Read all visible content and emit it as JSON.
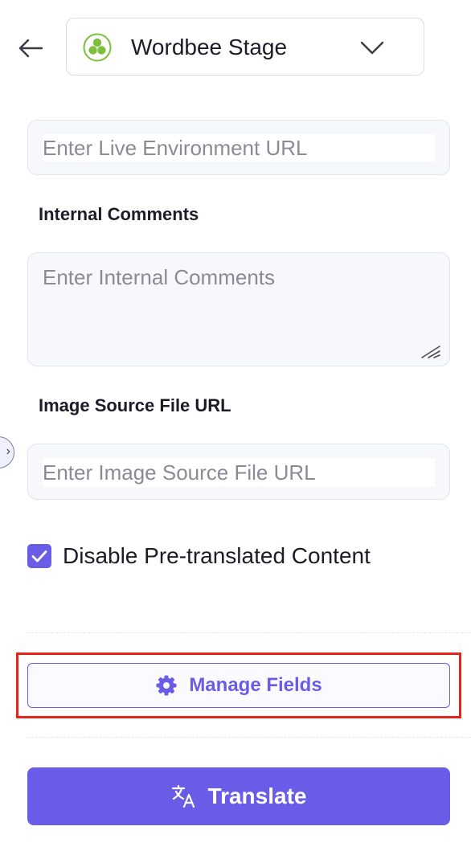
{
  "header": {
    "back_icon": "arrow-left-icon",
    "project": {
      "name": "Wordbee Stage",
      "logo_icon": "wordbee-logo-icon",
      "logo_color": "#7cbf3a",
      "dropdown_icon": "chevron-down-icon"
    }
  },
  "form": {
    "live_url": {
      "placeholder": "Enter Live Environment URL",
      "value": ""
    },
    "internal_comments": {
      "label": "Internal Comments",
      "placeholder": "Enter Internal Comments",
      "value": ""
    },
    "image_source_url": {
      "label": "Image Source File URL",
      "placeholder": "Enter Image Source File URL",
      "value": ""
    },
    "disable_pretranslated": {
      "label": "Disable Pre-translated Content",
      "checked": true
    }
  },
  "side_handle": {
    "icon": "chevron-right-icon"
  },
  "actions": {
    "manage_fields": {
      "label": "Manage Fields",
      "icon": "gear-icon"
    },
    "translate": {
      "label": "Translate",
      "icon": "translate-icon"
    }
  },
  "colors": {
    "accent": "#6b5ce7",
    "highlight": "#e8241a",
    "text": "#1c1c28",
    "placeholder": "#8a8b96"
  }
}
